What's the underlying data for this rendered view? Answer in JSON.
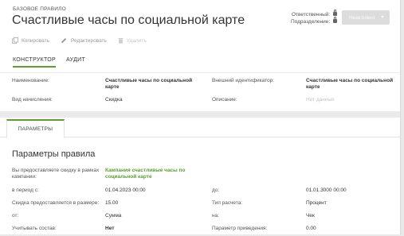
{
  "header": {
    "eyebrow": "БАЗОВОЕ ПРАВИЛО",
    "title": "Счастливые часы по социальной карте",
    "responsible_label": "Ответственный:",
    "division_label": "Подразделение:",
    "status_button": "Неактивно",
    "actions": {
      "copy": "Копировать",
      "edit": "Редактировать",
      "delete": "Удалить"
    },
    "tabs": [
      "КОНСТРУКТОР",
      "АУДИТ"
    ]
  },
  "info": {
    "name_label": "Наименование:",
    "name_value": "Счастливые часы по социальной карте",
    "external_id_label": "Внешний идентификатор:",
    "external_id_value": "Счастливые часы по социальной карте",
    "accrual_label": "Вид начисления:",
    "accrual_value": "Скидка",
    "description_label": "Описание:",
    "description_value": "Нет данных"
  },
  "params": {
    "tab": "ПАРАМЕТРЫ",
    "title": "Параметры правила",
    "campaign_label": "Вы предоставляете скидку в рамках кампании:",
    "campaign_value": "Кампания счастливые часы по социальной карте",
    "period_from_label": "в период с:",
    "period_from_value": "01.04.2023 00:00",
    "period_to_label": "до:",
    "period_to_value": "01.01.3000 00:00",
    "discount_label": "Скидка предоставляется в размере:",
    "discount_value": "15.00",
    "calc_type_label": "Тип расчета:",
    "calc_type_value": "Процент",
    "from_label": "от:",
    "from_value": "Сумма",
    "on_label": "на:",
    "on_value": "Чек",
    "composition_label": "Учитывать состав:",
    "composition_value": "Нет",
    "cast_param_label": "Параметр приведения:",
    "cast_param_value": "0.00"
  },
  "colors": {
    "accent": "#5aa02c",
    "status_button_bg": "#dcdcdc"
  }
}
